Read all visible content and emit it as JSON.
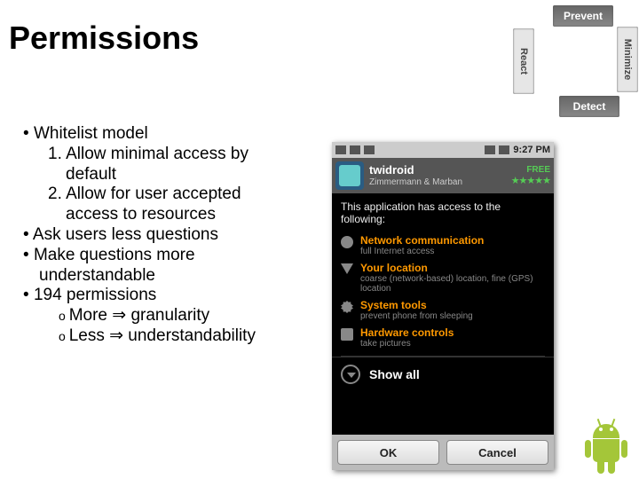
{
  "title": "Permissions",
  "cycle": {
    "prevent": "Prevent",
    "minimize": "Minimize",
    "detect": "Detect",
    "react": "React"
  },
  "bullets": {
    "b1": "Whitelist model",
    "b1n1a": "1. Allow minimal access by",
    "b1n1b": "default",
    "b1n2a": "2. Allow for user accepted",
    "b1n2b": "access to resources",
    "b2": "Ask users less questions",
    "b3a": "Make questions more",
    "b3b": "understandable",
    "b4": "194 permissions",
    "b4s1": "More ⇒ granularity",
    "b4s2": "Less ⇒ understandability"
  },
  "phone": {
    "time": "9:27 PM",
    "app_name": "twidroid",
    "publisher": "Zimmermann & Marban",
    "price": "FREE",
    "stars": "★★★★★",
    "prompt": "This application has access to the following:",
    "permissions": [
      {
        "icon": "network-icon",
        "title": "Network communication",
        "desc": "full Internet access"
      },
      {
        "icon": "location-icon",
        "title": "Your location",
        "desc": "coarse (network-based) location, fine (GPS) location"
      },
      {
        "icon": "system-icon",
        "title": "System tools",
        "desc": "prevent phone from sleeping"
      },
      {
        "icon": "hardware-icon",
        "title": "Hardware controls",
        "desc": "take pictures"
      }
    ],
    "show_all": "Show all",
    "ok": "OK",
    "cancel": "Cancel"
  }
}
